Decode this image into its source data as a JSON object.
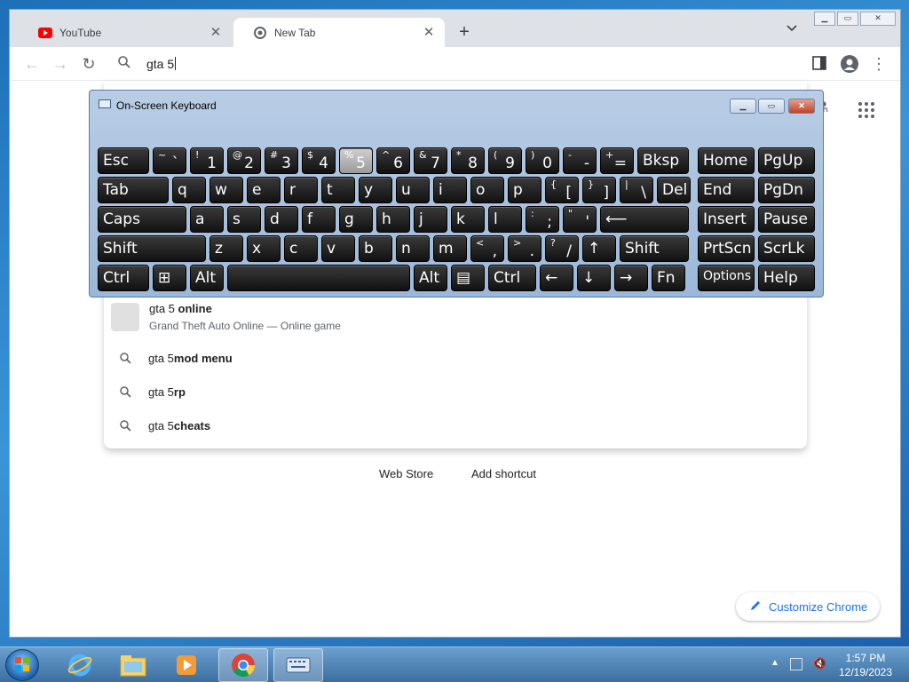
{
  "browser": {
    "tabs": [
      {
        "title": "YouTube",
        "active": false,
        "icon": "youtube-icon"
      },
      {
        "title": "New Tab",
        "active": true,
        "icon": "chrome-icon"
      }
    ],
    "new_tab_label": "+",
    "omnibox": {
      "value": "gta 5"
    },
    "suggestions": [
      {
        "prefix": "gta 5 ",
        "bold": "online",
        "subtitle": "Grand Theft Auto Online — Online game"
      },
      {
        "prefix": "gta 5 ",
        "bold": "mod menu"
      },
      {
        "prefix": "gta 5 ",
        "bold": "rp"
      },
      {
        "prefix": "gta 5 ",
        "bold": "cheats"
      }
    ],
    "shortcuts": {
      "web_store": "Web Store",
      "add_shortcut": "Add shortcut"
    },
    "customize_label": "Customize Chrome"
  },
  "osk": {
    "title": "On-Screen Keyboard",
    "rows": [
      [
        {
          "main": "Esc"
        },
        {
          "top": "~",
          "bot": "`"
        },
        {
          "top": "!",
          "bot": "1"
        },
        {
          "top": "@",
          "bot": "2"
        },
        {
          "top": "#",
          "bot": "3"
        },
        {
          "top": "$",
          "bot": "4"
        },
        {
          "top": "%",
          "bot": "5",
          "hl": true
        },
        {
          "top": "^",
          "bot": "6"
        },
        {
          "top": "&",
          "bot": "7"
        },
        {
          "top": "*",
          "bot": "8"
        },
        {
          "top": "(",
          "bot": "9"
        },
        {
          "top": ")",
          "bot": "0"
        },
        {
          "top": "-",
          "bot": "-"
        },
        {
          "top": "+",
          "bot": "="
        },
        {
          "main": "Bksp"
        },
        {
          "main": "Home"
        },
        {
          "main": "PgUp"
        }
      ],
      [
        {
          "main": "Tab"
        },
        {
          "main": "q"
        },
        {
          "main": "w"
        },
        {
          "main": "e"
        },
        {
          "main": "r"
        },
        {
          "main": "t"
        },
        {
          "main": "y"
        },
        {
          "main": "u"
        },
        {
          "main": "i"
        },
        {
          "main": "o"
        },
        {
          "main": "p"
        },
        {
          "top": "{",
          "bot": "["
        },
        {
          "top": "}",
          "bot": "]"
        },
        {
          "top": "|",
          "bot": "\\"
        },
        {
          "main": "Del"
        },
        {
          "main": "End"
        },
        {
          "main": "PgDn"
        }
      ],
      [
        {
          "main": "Caps"
        },
        {
          "main": "a"
        },
        {
          "main": "s"
        },
        {
          "main": "d"
        },
        {
          "main": "f"
        },
        {
          "main": "g"
        },
        {
          "main": "h"
        },
        {
          "main": "j"
        },
        {
          "main": "k"
        },
        {
          "main": "l"
        },
        {
          "top": ":",
          "bot": ";"
        },
        {
          "top": "\"",
          "bot": "'"
        },
        {
          "main": "⟵"
        },
        {
          "main": "Insert"
        },
        {
          "main": "Pause"
        }
      ],
      [
        {
          "main": "Shift"
        },
        {
          "main": "z"
        },
        {
          "main": "x"
        },
        {
          "main": "c"
        },
        {
          "main": "v"
        },
        {
          "main": "b"
        },
        {
          "main": "n"
        },
        {
          "main": "m"
        },
        {
          "top": "<",
          "bot": ","
        },
        {
          "top": ">",
          "bot": "."
        },
        {
          "top": "?",
          "bot": "/"
        },
        {
          "main": "↑"
        },
        {
          "main": "Shift"
        },
        {
          "main": "PrtScn"
        },
        {
          "main": "ScrLk"
        }
      ],
      [
        {
          "main": "Ctrl"
        },
        {
          "main": "⊞"
        },
        {
          "main": "Alt"
        },
        {
          "main": ""
        },
        {
          "main": "Alt"
        },
        {
          "main": "▤"
        },
        {
          "main": "Ctrl"
        },
        {
          "main": "←"
        },
        {
          "main": "↓"
        },
        {
          "main": "→"
        },
        {
          "main": "Fn"
        },
        {
          "main": "Options"
        },
        {
          "main": "Help"
        }
      ]
    ]
  },
  "taskbar": {
    "clock": {
      "time": "1:57 PM",
      "date": "12/19/2023"
    },
    "items": [
      "internet-explorer-icon",
      "file-explorer-icon",
      "media-player-icon",
      "chrome-icon",
      "on-screen-keyboard-icon"
    ]
  }
}
